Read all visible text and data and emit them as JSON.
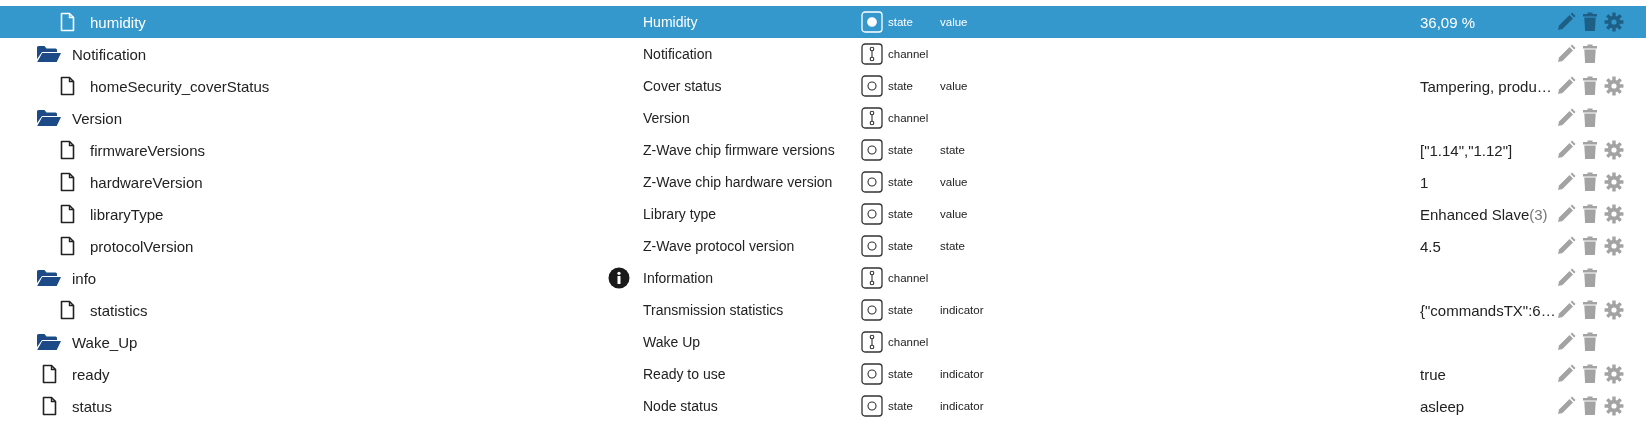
{
  "tree": [
    {
      "children": [
        {
          "name": "humidity",
          "kind": "file",
          "selected": true,
          "description": "Humidity",
          "info": false,
          "type": "state",
          "role": "value",
          "value": "36,09 %"
        }
      ]
    },
    {
      "name": "Notification",
      "kind": "folder",
      "selected": false,
      "description": "Notification",
      "info": false,
      "type": "channel",
      "children": [
        {
          "name": "homeSecurity_coverStatus",
          "kind": "file",
          "selected": false,
          "description": "Cover status",
          "info": false,
          "type": "state",
          "role": "value",
          "value": "Tampering, produ…"
        }
      ]
    },
    {
      "name": "Version",
      "kind": "folder",
      "selected": false,
      "description": "Version",
      "info": false,
      "type": "channel",
      "children": [
        {
          "name": "firmwareVersions",
          "kind": "file",
          "selected": false,
          "description": "Z-Wave chip firmware versions",
          "info": false,
          "type": "state",
          "role": "state",
          "value": "[\"1.14\",\"1.12\"]"
        },
        {
          "name": "hardwareVersion",
          "kind": "file",
          "selected": false,
          "description": "Z-Wave chip hardware version",
          "info": false,
          "type": "state",
          "role": "value",
          "value": "1"
        },
        {
          "name": "libraryType",
          "kind": "file",
          "selected": false,
          "description": "Library type",
          "info": false,
          "type": "state",
          "role": "value",
          "value": "Enhanced Slave",
          "value_suffix": "(3)"
        },
        {
          "name": "protocolVersion",
          "kind": "file",
          "selected": false,
          "description": "Z-Wave protocol version",
          "info": false,
          "type": "state",
          "role": "state",
          "value": "4.5"
        }
      ]
    },
    {
      "name": "info",
      "kind": "folder",
      "selected": false,
      "description": "Information",
      "info": true,
      "type": "channel",
      "children": [
        {
          "name": "statistics",
          "kind": "file",
          "selected": false,
          "description": "Transmission statistics",
          "info": false,
          "type": "state",
          "role": "indicator",
          "value": "{\"commandsTX\":6…"
        }
      ]
    },
    {
      "name": "Wake_Up",
      "kind": "folder",
      "selected": false,
      "description": "Wake Up",
      "info": false,
      "type": "channel"
    },
    {
      "name": "ready",
      "kind": "file",
      "selected": false,
      "description": "Ready to use",
      "info": false,
      "type": "state",
      "role": "indicator",
      "value": "true"
    },
    {
      "name": "status",
      "kind": "file",
      "selected": false,
      "description": "Node status",
      "info": false,
      "type": "state",
      "role": "indicator",
      "value": "asleep"
    }
  ]
}
